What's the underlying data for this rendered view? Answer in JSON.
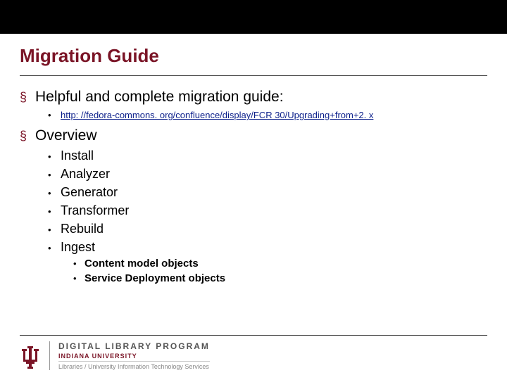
{
  "title": "Migration Guide",
  "bullets": {
    "helpful": "Helpful and complete migration guide:",
    "link": "http: //fedora-commons. org/confluence/display/FCR 30/Upgrading+from+2. x",
    "overview": "Overview",
    "items": [
      "Install",
      "Analyzer",
      "Generator",
      "Transformer",
      "Rebuild",
      "Ingest"
    ],
    "sub": [
      "Content model objects",
      "Service Deployment objects"
    ]
  },
  "footer": {
    "program": "DIGITAL LIBRARY PROGRAM",
    "institution": "INDIANA UNIVERSITY",
    "dept": "Libraries / University Information Technology Services"
  }
}
